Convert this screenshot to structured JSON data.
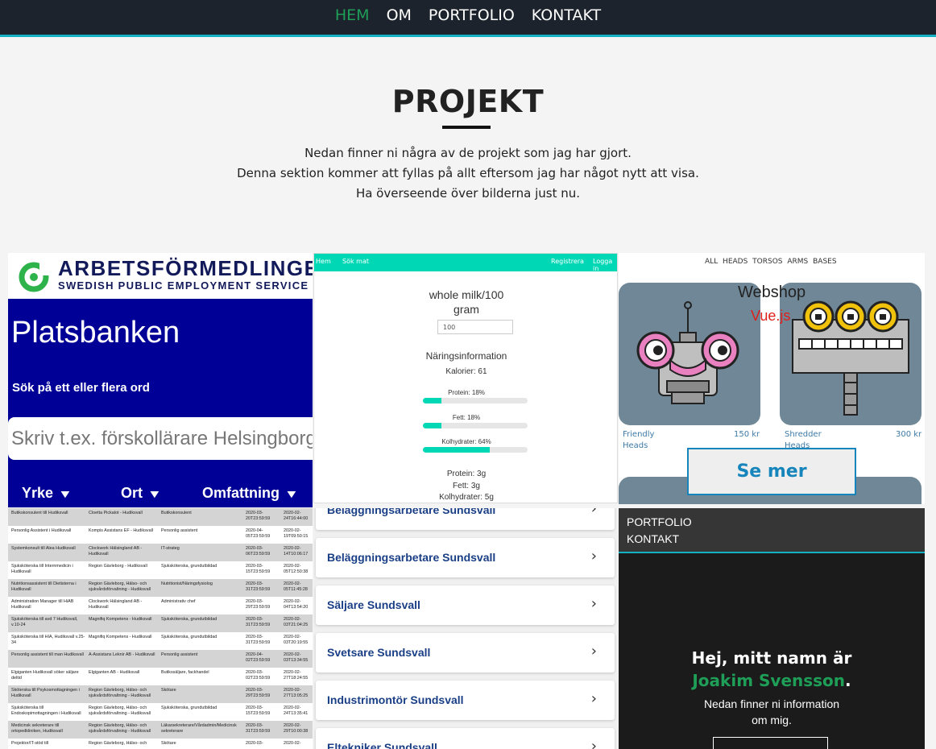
{
  "nav": {
    "items": [
      {
        "label": "HEM",
        "active": true
      },
      {
        "label": "OM"
      },
      {
        "label": "PORTFOLIO"
      },
      {
        "label": "KONTAKT"
      }
    ],
    "accent": "#1e9e57",
    "underline_color": "#12b2c4"
  },
  "hero": {
    "title": "PROJEKT",
    "lines": [
      "Nedan finner ni några av de projekt som jag har gjort.",
      "Denna sektion kommer att fyllas på allt eftersom jag har något nytt att visa.",
      "Ha överseende över bilderna just nu."
    ]
  },
  "tiles": {
    "platsbanken": {
      "logo_title": "ARBETSFÖRMEDLINGEN",
      "logo_subtitle": "SWEDISH PUBLIC EMPLOYMENT SERVICE",
      "heading": "Platsbanken",
      "search_label": "Sök på ett eller flera ord",
      "search_placeholder": "Skriv t.ex. förskollärare Helsingborg",
      "filters": [
        "Yrke",
        "Ort",
        "Omfattning"
      ]
    },
    "nutrition": {
      "nav": {
        "home": "Hem",
        "search": "Sök mat",
        "register": "Registrera",
        "login": "Logga in"
      },
      "food_title_1": "whole milk/100",
      "food_title_2": "gram",
      "amount": "100",
      "section": "Näringsinformation",
      "calories": "Kalorier: 61",
      "bars": [
        {
          "label": "Protein: 18%",
          "value": 18
        },
        {
          "label": "Fett: 18%",
          "value": 18
        },
        {
          "label": "Kolhydrater: 64%",
          "value": 64
        }
      ],
      "grams": [
        "Protein: 3g",
        "Fett: 3g",
        "Kolhydrater: 5g"
      ]
    },
    "webshop": {
      "links": "ALL  HEADS  TORSOS  ARMS  BASES",
      "title": "Webshop",
      "subtitle": "Vue.js",
      "products": [
        {
          "name_1": "Friendly",
          "name_2": "Heads",
          "price": "150 kr"
        },
        {
          "name_1": "Shredder",
          "name_2": "Heads",
          "price": "300 kr"
        }
      ],
      "button": "Se mer"
    },
    "jobtable": {
      "rows": [
        [
          "Butikskonsulent till Hudiksvall",
          "Cloetta Pickalot - Hudiksvall",
          "Butikskonsulent",
          "2020-03-20T23:59:59",
          "2020-02-24T16:44:00"
        ],
        [
          "Personlig Assistent i Hudiksvall",
          "Kompis Assistans EF - Hudiksvall",
          "Personlig assistent",
          "2020-04-05T23:59:59",
          "2020-02-19T09:50:15"
        ],
        [
          "Systemkonsult till Alea Hudiksvall",
          "Clockwork Hälsingland AB - Hudiksvall",
          "IT-strateg",
          "2020-03-06T23:59:59",
          "2020-02-14T10:06:17"
        ],
        [
          "Sjuksköterska till Internmedicin i Hudiksvall",
          "Region Gävleborg - Hudiksvall",
          "Sjuksköterska, grundutbildad",
          "2020-03-15T23:59:59",
          "2020-02-05T12:50:38"
        ],
        [
          "Nutritionsassistent till Dietisterna i Hudiksvall",
          "Region Gävleborg, Hälso- och sjukvårdsförvaltning - Hudiksvall",
          "Nutritionist/Näringsfysiolog",
          "2020-03-31T23:59:59",
          "2020-02-05T11:45:28"
        ],
        [
          "Administration Manager till HiAB Hudiksvall",
          "Clockwork Hälsingland AB - Hudiksvall",
          "Administrativ chef",
          "2020-03-29T23:59:59",
          "2020-02-04T13:54:20"
        ],
        [
          "Sjuksköterska till avd 7 Hudiksvall, v.10-24",
          "Magnifiq Kompetens - Hudiksvall",
          "Sjuksköterska, grundutbildad",
          "2020-03-31T23:59:59",
          "2020-02-03T21:04:25"
        ],
        [
          "Sjuksköterska till HIA, Hudiksvall v.25-34",
          "Magnifiq Kompetens - Hudiksvall",
          "Sjuksköterska, grundutbildad",
          "2020-03-31T23:59:59",
          "2020-02-03T20:19:55"
        ],
        [
          "Personlig assistent till man Hudiksvall",
          "A-Assistans Leknir AB - Hudiksvall",
          "Personlig assistent",
          "2020-04-02T23:59:59",
          "2020-02-03T13:34:55"
        ],
        [
          "Elgiganten Hudiksvall söker säljare deltid",
          "Elgiganten AB - Hudiksvall",
          "Butikssäljare, fackhandel",
          "2020-03-02T23:59:59",
          "2020-02-27T18:24:55"
        ],
        [
          "Sköterska till Psykosmottagningen i Hudiksvall",
          "Region Gävleborg, Hälso- och sjukvårdsförvaltning - Hudiksvall",
          "Skötare",
          "2020-03-29T23:59:59",
          "2020-02-27T13:05:25"
        ],
        [
          "Sjuksköterska till Endoskopimottagningen i Hudiksvall",
          "Region Gävleborg, Hälso- och sjukvårdsförvaltning - Hudiksvall",
          "Sjuksköterska, grundutbildad",
          "2020-03-15T23:59:59",
          "2020-02-24T13:35:41"
        ],
        [
          "Medicinsk sekreterare till ortopedkliniken, Hudiksvall",
          "Region Gävleborg, Hälso- och sjukvårdsförvaltning - Hudiksvall",
          "Läkarsekreterare/Vårdadmin/Medicinsk sekreterare",
          "2020-03-31T23:59:59",
          "2020-02-29T10:00:38"
        ],
        [
          "Projektor/IT-stöd till",
          "Region Gävleborg, Hälso- och",
          "Skötare",
          "2020-03-",
          "2020-02-"
        ]
      ]
    },
    "joblist": {
      "items": [
        "Beläggningsarbetare Sundsvall",
        "Beläggningsarbetare Sundsvall",
        "Säljare Sundsvall",
        "Svetsare Sundsvall",
        "Industrimontör Sundsvall",
        "Eltekniker Sundsvall"
      ]
    },
    "portfolio": {
      "menu": [
        "PORTFOLIO",
        "KONTAKT"
      ],
      "greeting": "Hej, mitt namn är",
      "name": "Joakim Svensson",
      "name_suffix": ".",
      "text_1": "Nedan finner ni information",
      "text_2": "om mig."
    }
  }
}
